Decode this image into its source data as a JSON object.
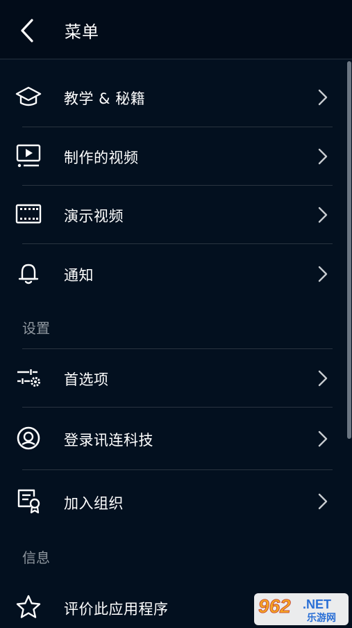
{
  "header": {
    "title": "菜单"
  },
  "menu": {
    "tutorials": "教学 & 秘籍",
    "created_videos": "制作的视频",
    "demo_videos": "演示视频",
    "notifications": "通知"
  },
  "settings": {
    "section_label": "设置",
    "preferences": "首选项",
    "login": "登录讯连科技",
    "join_org": "加入组织"
  },
  "info": {
    "section_label": "信息",
    "rate_app": "评价此应用程序"
  },
  "watermark": {
    "number": "962",
    "suffix": ".NET",
    "subtitle": "乐游网"
  },
  "colors": {
    "background": "#03101f",
    "header": "#020c19",
    "divider": "#2a3440",
    "section_text": "#8f979f"
  }
}
